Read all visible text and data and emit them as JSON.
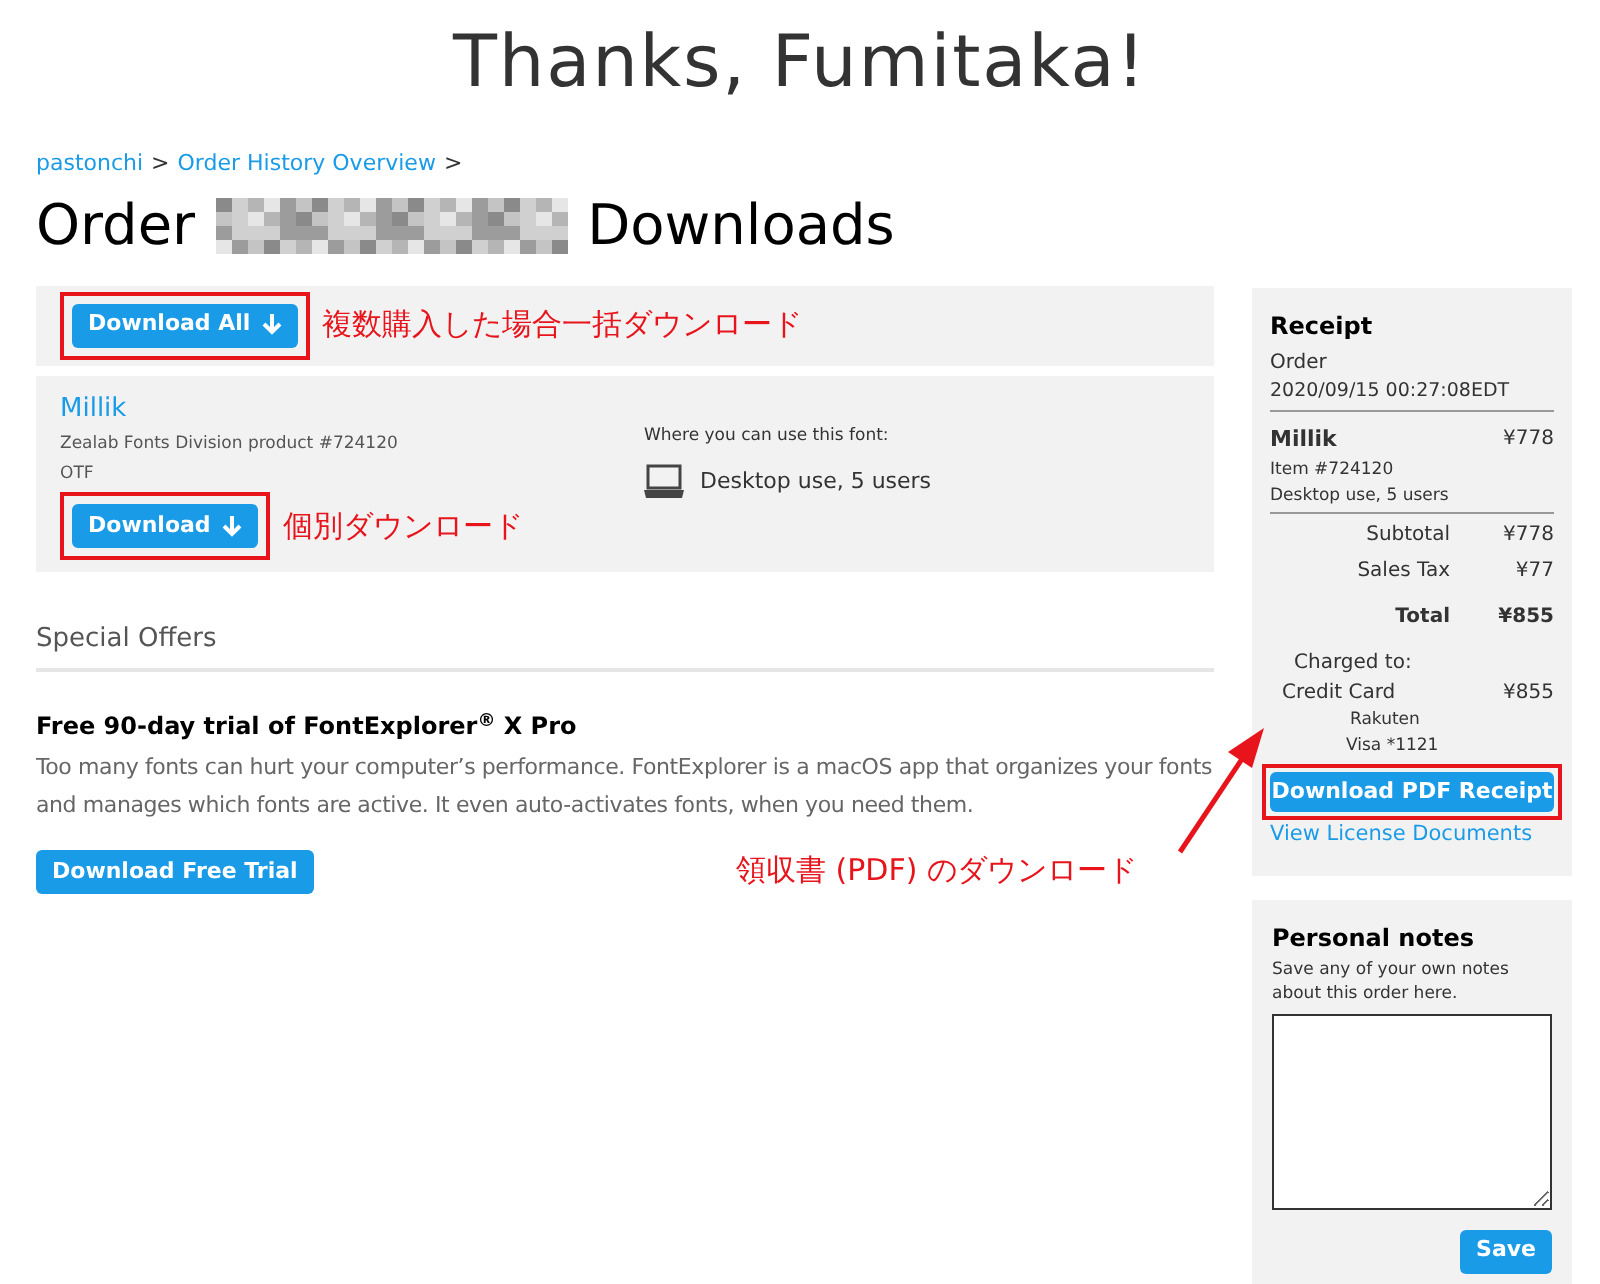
{
  "heading": "Thanks, Fumitaka!",
  "breadcrumbs": [
    {
      "label": "pastonchi",
      "separator": ">"
    },
    {
      "label": "Order History Overview",
      "separator": ">"
    }
  ],
  "title": {
    "before": "Order",
    "after": "Downloads"
  },
  "download_all": {
    "label": "Download All",
    "annotation": "複数購入した場合一括ダウンロード"
  },
  "product": {
    "name": "Millik",
    "vendor": "Zealab Fonts Division product #724120",
    "format": "OTF",
    "download_label": "Download",
    "annotation": "個別ダウンロード",
    "usage_heading": "Where you can use this font:",
    "usage": "Desktop use, 5 users"
  },
  "special_offers": {
    "heading": "Special Offers",
    "offer_title": "Free 90-day trial of FontExplorer$^{®}$ X Pro",
    "offer_text": "Too many fonts can hurt your computer’s performance. FontExplorer is a macOS app that organizes your fonts and manages which fonts are active. It even auto-activates fonts, when you need them.",
    "button": "Download Free Trial"
  },
  "receipt": {
    "heading": "Receipt",
    "order_label": "Order",
    "order_date": "2020/09/15 00:27:08EDT",
    "item_name": "Millik",
    "item_price": "¥778",
    "item_number": "Item #724120",
    "item_license": "Desktop use, 5 users",
    "totals": [
      {
        "label": "Subtotal",
        "value": "¥778",
        "bold": false
      },
      {
        "label": "Sales Tax",
        "value": "¥77",
        "bold": false
      },
      {
        "label": "Total",
        "value": "¥855",
        "bold": true
      }
    ],
    "charged_label": "Charged to:",
    "method": "Credit Card",
    "charged_value": "¥855",
    "card_issuer": "Rakuten",
    "card": "Visa *1121",
    "pdf_button": "Download PDF Receipt",
    "pdf_annotation": "領収書 (PDF) のダウンロード",
    "license_link": "View License Documents"
  },
  "notes": {
    "heading": "Personal notes",
    "hint": "Save any of your own notes about this order here.",
    "save": "Save"
  }
}
